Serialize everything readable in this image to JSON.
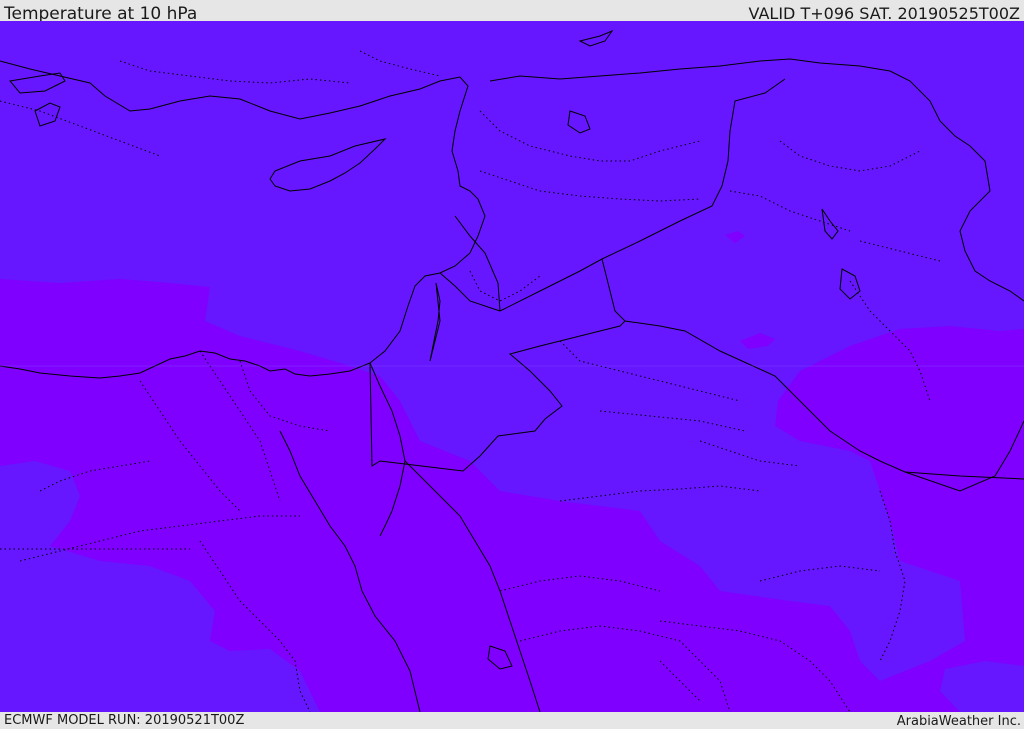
{
  "header": {
    "title": "Temperature at 10 hPa",
    "valid_time": "VALID T+096 SAT. 20190525T00Z"
  },
  "footer": {
    "model_run": "ECMWF MODEL RUN: 20190521T00Z",
    "provider": "ArabiaWeather Inc."
  },
  "map": {
    "colors": {
      "field_blue_violet": "#6617ff",
      "field_violet": "#7f00ff",
      "coastline": "#000000",
      "border_dotted": "#000000"
    }
  }
}
